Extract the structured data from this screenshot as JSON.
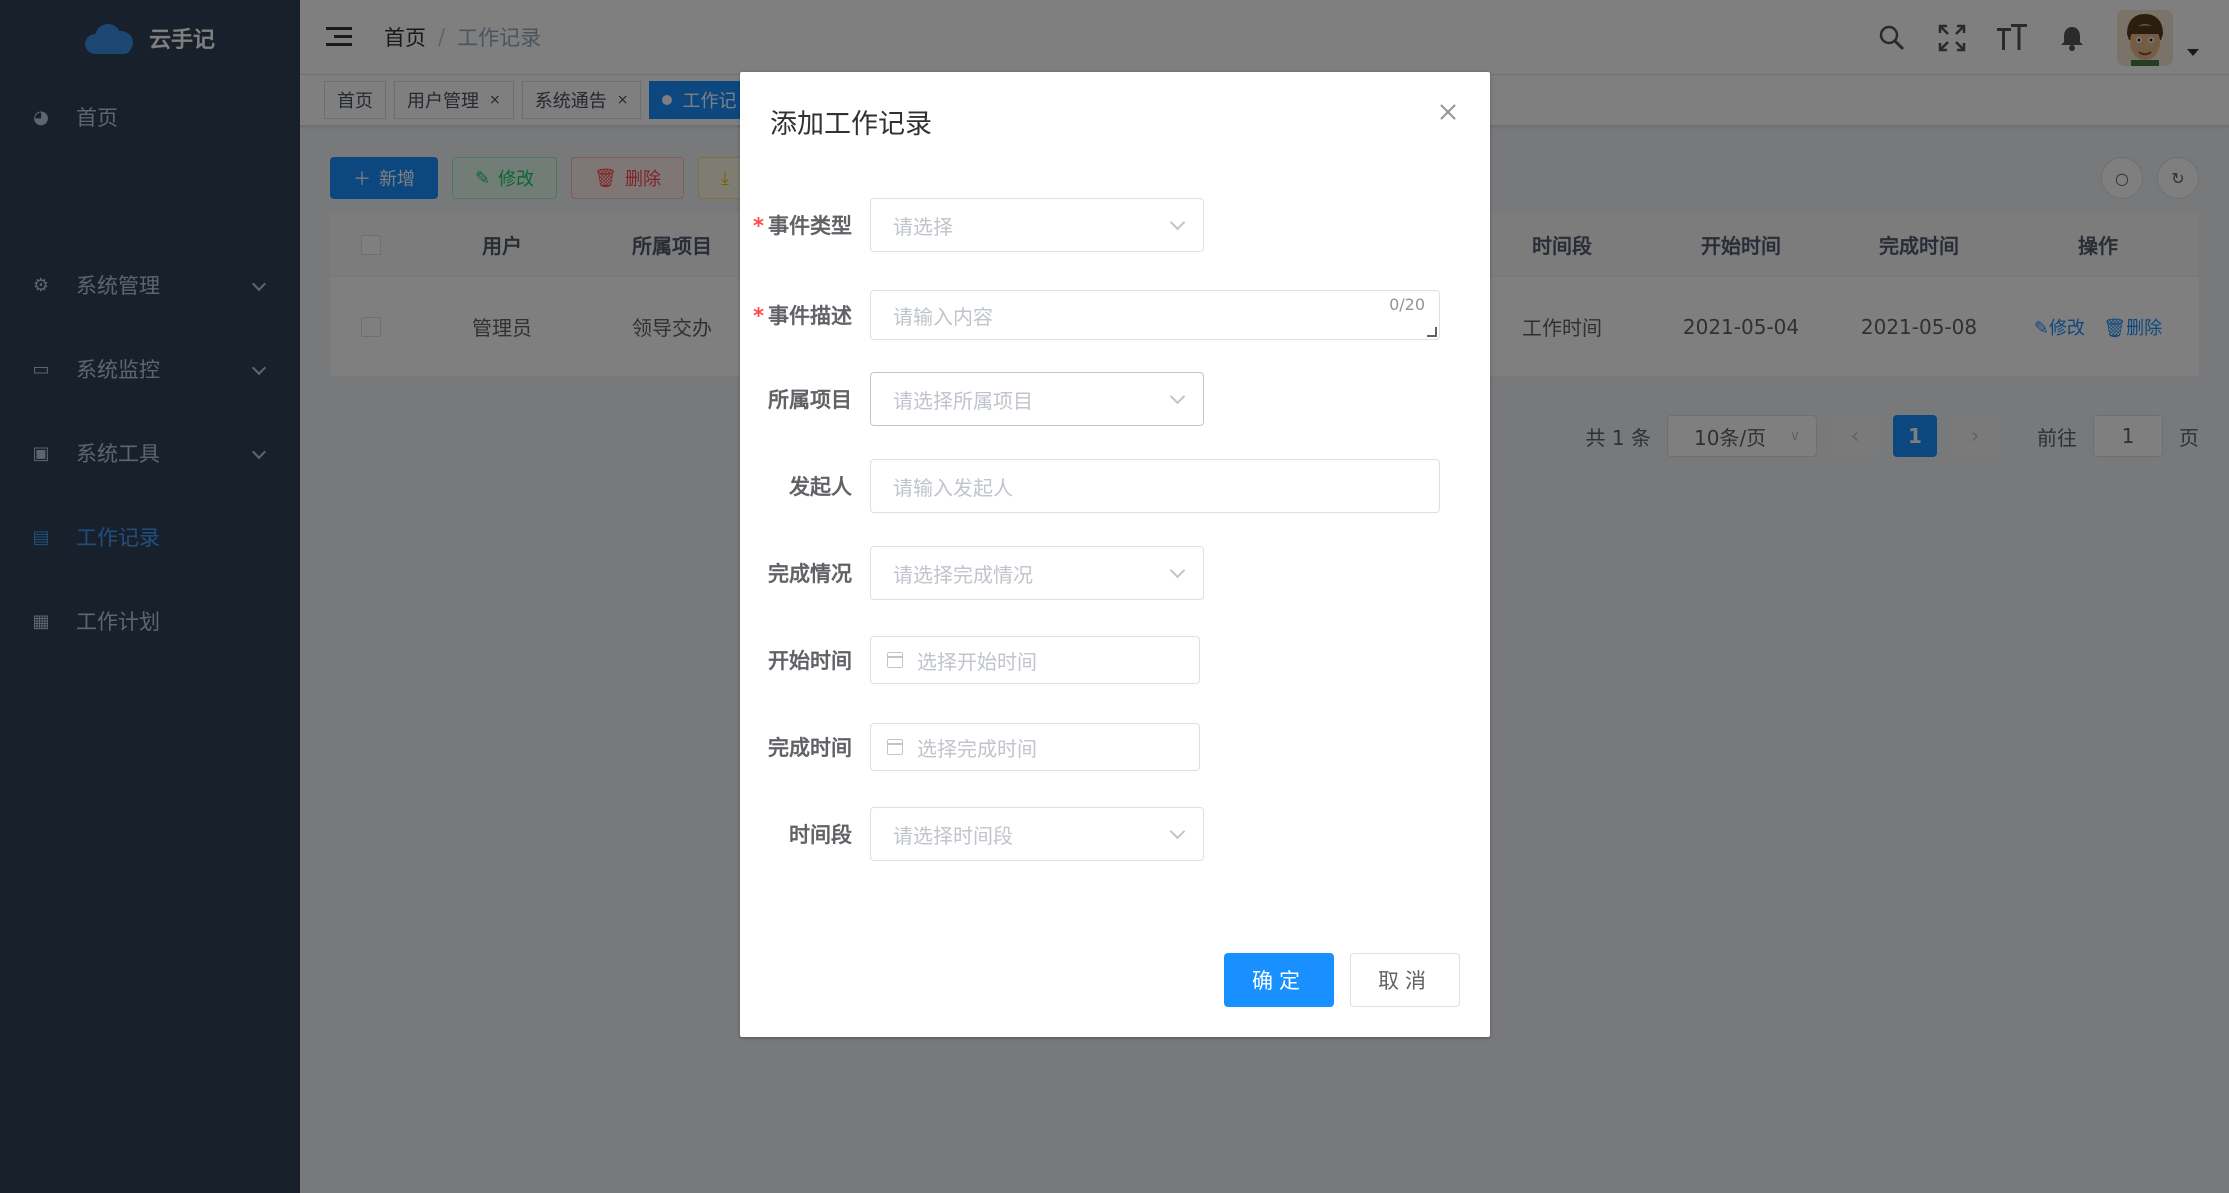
{
  "sidebar": {
    "logo_text": "云手记",
    "items": [
      {
        "label": "首页",
        "icon": "dashboard-icon"
      },
      {
        "label": "系统管理",
        "icon": "gear-icon"
      },
      {
        "label": "系统监控",
        "icon": "monitor-icon"
      },
      {
        "label": "系统工具",
        "icon": "toolbox-icon"
      },
      {
        "label": "工作记录",
        "icon": "document-icon"
      },
      {
        "label": "工作计划",
        "icon": "calendar-icon"
      }
    ],
    "active_color": "#409eff"
  },
  "navbar": {
    "breadcrumb": {
      "home": "首页",
      "sep": "/",
      "current": "工作记录"
    },
    "icons": [
      "search-icon",
      "fullscreen-icon",
      "font-size-icon",
      "bell-icon"
    ]
  },
  "tags": {
    "items": [
      {
        "label": "首页"
      },
      {
        "label": "用户管理",
        "close": "×"
      },
      {
        "label": "系统通告",
        "close": "×"
      },
      {
        "label": "工作记"
      }
    ]
  },
  "toolbar": {
    "add": "新增",
    "edit": "修改",
    "delete": "删除"
  },
  "table": {
    "headers": [
      "用户",
      "所属项目",
      "时间段",
      "开始时间",
      "完成时间",
      "操作"
    ],
    "rows": [
      {
        "user": "管理员",
        "project": "领导交办",
        "period": "工作时间",
        "start": "2021-05-04",
        "end": "2021-05-08",
        "edit": "修改",
        "delete": "删除"
      }
    ]
  },
  "pagination": {
    "total": "共 1 条",
    "size": "10条/页",
    "current": "1",
    "goto_label": "前往",
    "goto_value": "1",
    "page_suffix": "页"
  },
  "dialog": {
    "title": "添加工作记录",
    "fields": {
      "event_type": {
        "label": "事件类型",
        "placeholder": "请选择"
      },
      "event_desc": {
        "label": "事件描述",
        "placeholder": "请输入内容",
        "counter": "0/20"
      },
      "project": {
        "label": "所属项目",
        "placeholder": "请选择所属项目"
      },
      "initiator": {
        "label": "发起人",
        "placeholder": "请输入发起人"
      },
      "status": {
        "label": "完成情况",
        "placeholder": "请选择完成情况"
      },
      "start_time": {
        "label": "开始时间",
        "placeholder": "选择开始时间"
      },
      "end_time": {
        "label": "完成时间",
        "placeholder": "选择完成时间"
      },
      "period": {
        "label": "时间段",
        "placeholder": "请选择时间段"
      }
    },
    "required_mark": "*",
    "ok": "确定",
    "cancel": "取消"
  }
}
